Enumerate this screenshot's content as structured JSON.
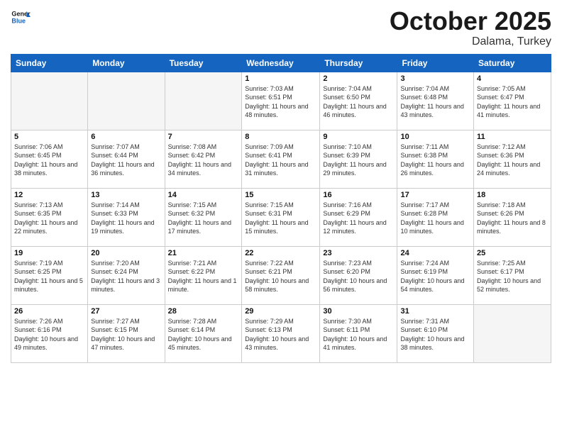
{
  "logo": {
    "line1": "General",
    "line2": "Blue"
  },
  "title": "October 2025",
  "subtitle": "Dalama, Turkey",
  "days_of_week": [
    "Sunday",
    "Monday",
    "Tuesday",
    "Wednesday",
    "Thursday",
    "Friday",
    "Saturday"
  ],
  "weeks": [
    [
      {
        "day": "",
        "info": ""
      },
      {
        "day": "",
        "info": ""
      },
      {
        "day": "",
        "info": ""
      },
      {
        "day": "1",
        "info": "Sunrise: 7:03 AM\nSunset: 6:51 PM\nDaylight: 11 hours and 48 minutes."
      },
      {
        "day": "2",
        "info": "Sunrise: 7:04 AM\nSunset: 6:50 PM\nDaylight: 11 hours and 46 minutes."
      },
      {
        "day": "3",
        "info": "Sunrise: 7:04 AM\nSunset: 6:48 PM\nDaylight: 11 hours and 43 minutes."
      },
      {
        "day": "4",
        "info": "Sunrise: 7:05 AM\nSunset: 6:47 PM\nDaylight: 11 hours and 41 minutes."
      }
    ],
    [
      {
        "day": "5",
        "info": "Sunrise: 7:06 AM\nSunset: 6:45 PM\nDaylight: 11 hours and 38 minutes."
      },
      {
        "day": "6",
        "info": "Sunrise: 7:07 AM\nSunset: 6:44 PM\nDaylight: 11 hours and 36 minutes."
      },
      {
        "day": "7",
        "info": "Sunrise: 7:08 AM\nSunset: 6:42 PM\nDaylight: 11 hours and 34 minutes."
      },
      {
        "day": "8",
        "info": "Sunrise: 7:09 AM\nSunset: 6:41 PM\nDaylight: 11 hours and 31 minutes."
      },
      {
        "day": "9",
        "info": "Sunrise: 7:10 AM\nSunset: 6:39 PM\nDaylight: 11 hours and 29 minutes."
      },
      {
        "day": "10",
        "info": "Sunrise: 7:11 AM\nSunset: 6:38 PM\nDaylight: 11 hours and 26 minutes."
      },
      {
        "day": "11",
        "info": "Sunrise: 7:12 AM\nSunset: 6:36 PM\nDaylight: 11 hours and 24 minutes."
      }
    ],
    [
      {
        "day": "12",
        "info": "Sunrise: 7:13 AM\nSunset: 6:35 PM\nDaylight: 11 hours and 22 minutes."
      },
      {
        "day": "13",
        "info": "Sunrise: 7:14 AM\nSunset: 6:33 PM\nDaylight: 11 hours and 19 minutes."
      },
      {
        "day": "14",
        "info": "Sunrise: 7:15 AM\nSunset: 6:32 PM\nDaylight: 11 hours and 17 minutes."
      },
      {
        "day": "15",
        "info": "Sunrise: 7:15 AM\nSunset: 6:31 PM\nDaylight: 11 hours and 15 minutes."
      },
      {
        "day": "16",
        "info": "Sunrise: 7:16 AM\nSunset: 6:29 PM\nDaylight: 11 hours and 12 minutes."
      },
      {
        "day": "17",
        "info": "Sunrise: 7:17 AM\nSunset: 6:28 PM\nDaylight: 11 hours and 10 minutes."
      },
      {
        "day": "18",
        "info": "Sunrise: 7:18 AM\nSunset: 6:26 PM\nDaylight: 11 hours and 8 minutes."
      }
    ],
    [
      {
        "day": "19",
        "info": "Sunrise: 7:19 AM\nSunset: 6:25 PM\nDaylight: 11 hours and 5 minutes."
      },
      {
        "day": "20",
        "info": "Sunrise: 7:20 AM\nSunset: 6:24 PM\nDaylight: 11 hours and 3 minutes."
      },
      {
        "day": "21",
        "info": "Sunrise: 7:21 AM\nSunset: 6:22 PM\nDaylight: 11 hours and 1 minute."
      },
      {
        "day": "22",
        "info": "Sunrise: 7:22 AM\nSunset: 6:21 PM\nDaylight: 10 hours and 58 minutes."
      },
      {
        "day": "23",
        "info": "Sunrise: 7:23 AM\nSunset: 6:20 PM\nDaylight: 10 hours and 56 minutes."
      },
      {
        "day": "24",
        "info": "Sunrise: 7:24 AM\nSunset: 6:19 PM\nDaylight: 10 hours and 54 minutes."
      },
      {
        "day": "25",
        "info": "Sunrise: 7:25 AM\nSunset: 6:17 PM\nDaylight: 10 hours and 52 minutes."
      }
    ],
    [
      {
        "day": "26",
        "info": "Sunrise: 7:26 AM\nSunset: 6:16 PM\nDaylight: 10 hours and 49 minutes."
      },
      {
        "day": "27",
        "info": "Sunrise: 7:27 AM\nSunset: 6:15 PM\nDaylight: 10 hours and 47 minutes."
      },
      {
        "day": "28",
        "info": "Sunrise: 7:28 AM\nSunset: 6:14 PM\nDaylight: 10 hours and 45 minutes."
      },
      {
        "day": "29",
        "info": "Sunrise: 7:29 AM\nSunset: 6:13 PM\nDaylight: 10 hours and 43 minutes."
      },
      {
        "day": "30",
        "info": "Sunrise: 7:30 AM\nSunset: 6:11 PM\nDaylight: 10 hours and 41 minutes."
      },
      {
        "day": "31",
        "info": "Sunrise: 7:31 AM\nSunset: 6:10 PM\nDaylight: 10 hours and 38 minutes."
      },
      {
        "day": "",
        "info": ""
      }
    ]
  ]
}
